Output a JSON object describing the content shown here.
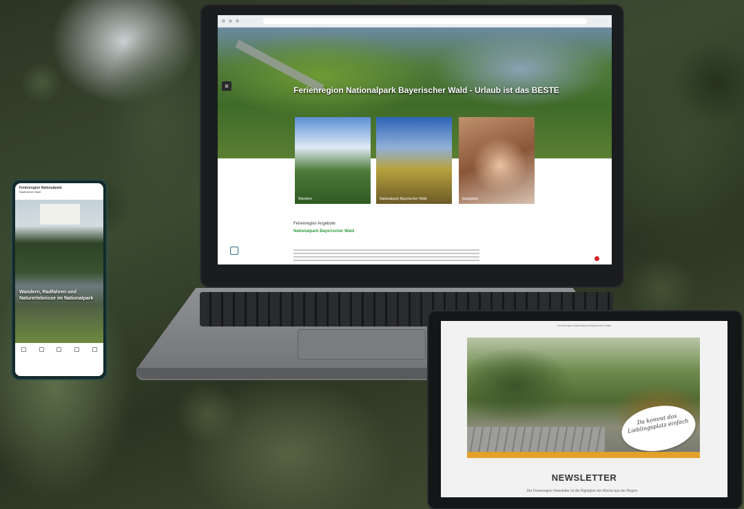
{
  "laptop": {
    "hero_title": "Ferienregion Nationalpark Bayerischer Wald - Urlaub ist das BESTE",
    "tiles": [
      {
        "caption": "Wandern"
      },
      {
        "caption": "Nationalpark Bayerischer Wald"
      },
      {
        "caption": "Gastgeber"
      }
    ],
    "subheading": "Ferienregion Angebote",
    "green_heading": "Nationalpark Bayerischer Wald"
  },
  "phone": {
    "header_title": "Ferienregion Nationalpark",
    "header_sub": "Bayerischer Wald",
    "overlay_text": "Wandern, Radfahren und Naturerlebnisse im Nationalpark"
  },
  "tablet": {
    "top_text": "Ferienregion Nationalpark Bayerischer Wald",
    "bubble_text": "Da kommt das Lieblingsplatz einfach",
    "newsletter_title": "NEWSLETTER",
    "newsletter_line": "Der Ferienregion Newsletter ist die Highlights der Woche aus der Region"
  },
  "colors": {
    "brand_green": "#2f9a38",
    "accent_orange": "#e3a12a",
    "accent_red": "#d4232a"
  }
}
